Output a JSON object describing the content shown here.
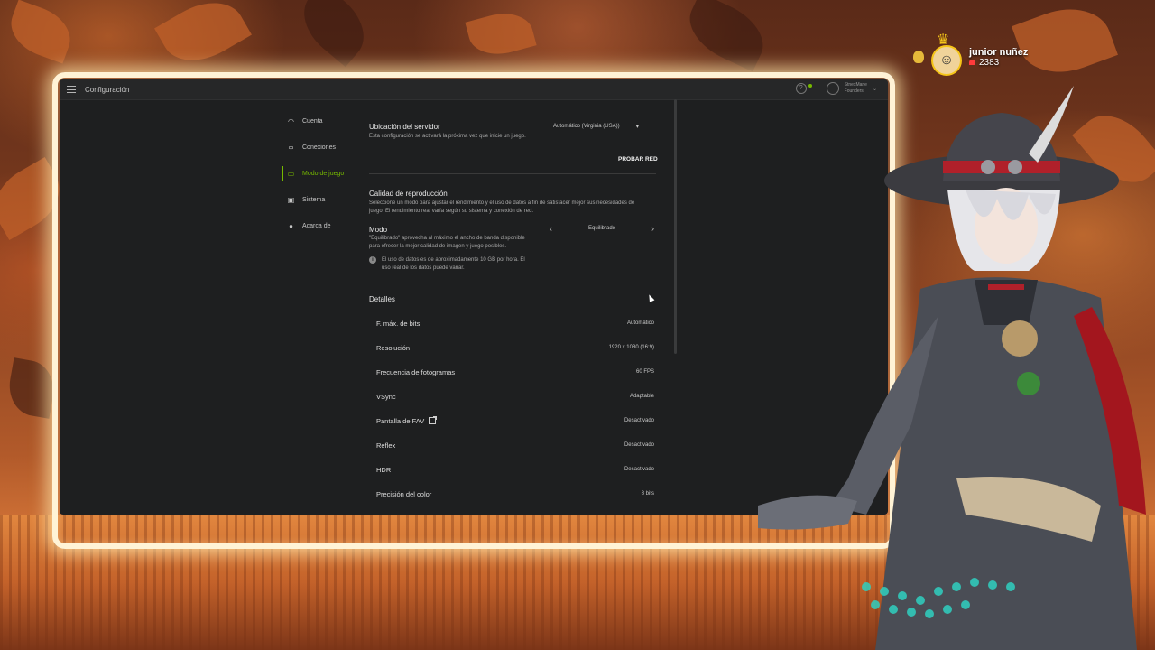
{
  "app": {
    "title": "Configuración",
    "user": {
      "name": "StnexMarie",
      "tier": "Founders"
    }
  },
  "sidebar": {
    "items": [
      {
        "label": "Cuenta",
        "icon": "headset-icon",
        "active": false
      },
      {
        "label": "Conexiones",
        "icon": "link-icon",
        "active": false
      },
      {
        "label": "Modo de juego",
        "icon": "display-icon",
        "active": true
      },
      {
        "label": "Sistema",
        "icon": "monitor-icon",
        "active": false
      },
      {
        "label": "Acarca de",
        "icon": "info-icon",
        "active": false
      }
    ]
  },
  "server": {
    "title": "Ubicación del servidor",
    "description": "Esta configuración se activará la próxima vez que inicie un juego.",
    "value": "Automático (Virginia (USA))",
    "test_button": "PROBAR RED"
  },
  "quality": {
    "title": "Calidad de reproducción",
    "description": "Seleccione un modo para ajustar el rendimiento y el uso de datos a fin de satisfacer mejor sus necesidades de juego. El rendimiento real varía según su sistema y conexión de red."
  },
  "mode": {
    "title": "Modo",
    "description": "\"Equilibrado\" aprovecha al máximo el ancho de banda disponible para ofrecer la mejor calidad de imagen y juego posibles.",
    "value": "Equilibrado",
    "note": "El uso de datos es de aproximadamente 10 GB por hora. El uso real de los datos puede variar."
  },
  "details": {
    "title": "Detalles",
    "rows": [
      {
        "label": "F. máx. de bits",
        "value": "Automático",
        "disabled": false
      },
      {
        "label": "Resolución",
        "value": "1920 x 1080 (16:9)",
        "disabled": false
      },
      {
        "label": "Frecuencia de fotogramas",
        "value": "60 FPS",
        "disabled": false
      },
      {
        "label": "VSync",
        "value": "Adaptable",
        "disabled": false
      },
      {
        "label": "Pantalla de FAV",
        "value": "Desactivado",
        "disabled": true
      },
      {
        "label": "Reflex",
        "value": "Desactivado",
        "disabled": true
      },
      {
        "label": "HDR",
        "value": "Desactivado",
        "disabled": false
      },
      {
        "label": "Precisión del color",
        "value": "8 bits",
        "disabled": true
      }
    ]
  },
  "overlay": {
    "viewer_name": "junior nuñez",
    "viewer_points": "2383"
  },
  "colors": {
    "accent": "#76b900",
    "panel": "#1e1f20",
    "frame_glow": "#fff3d6"
  }
}
